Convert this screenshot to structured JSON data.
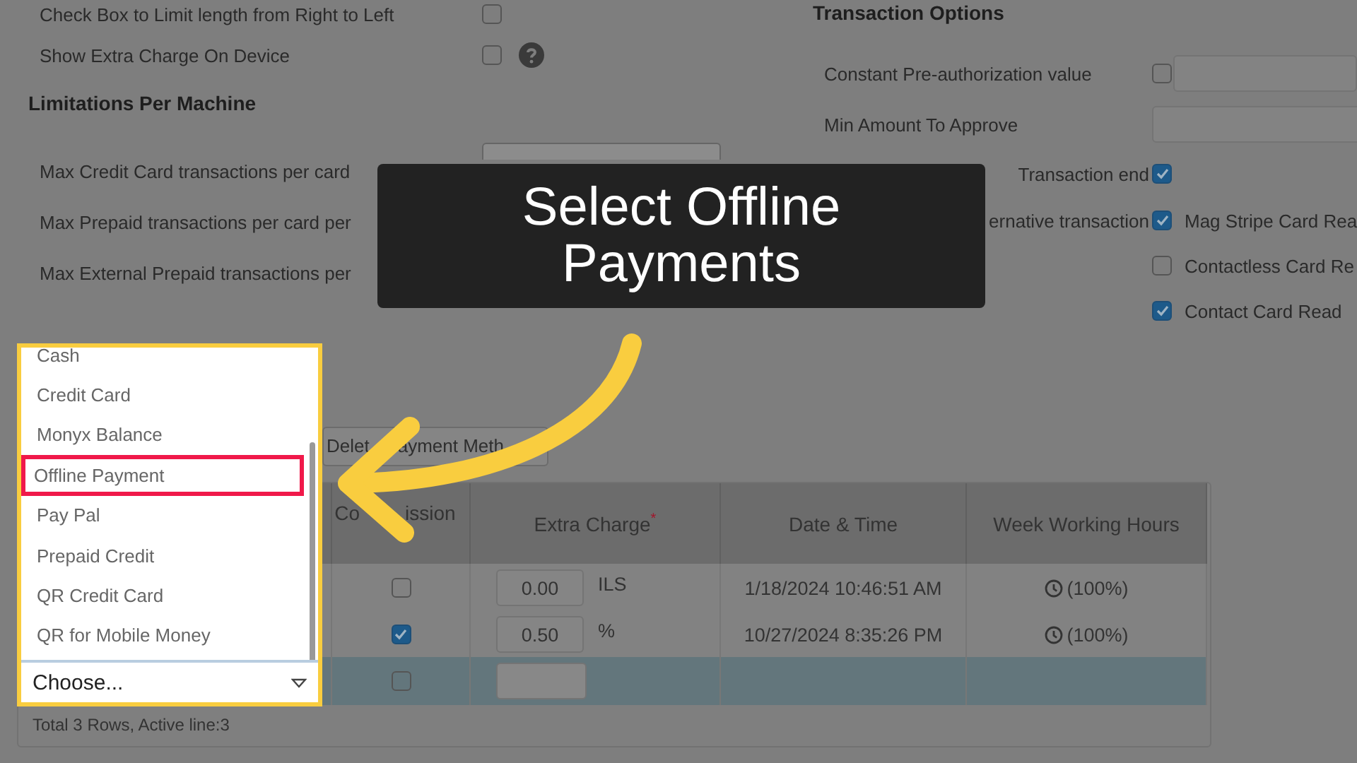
{
  "settings": {
    "rows": [
      {
        "label": "Check Box to Limit length from Right to Left",
        "checked": false
      },
      {
        "label": "Show Extra Charge On Device",
        "checked": false,
        "help": true
      }
    ]
  },
  "limitations": {
    "heading": "Limitations Per Machine",
    "rows": [
      {
        "label": "Max Credit Card transactions per card",
        "field": true
      },
      {
        "label": "Max Prepaid transactions per card per"
      },
      {
        "label": "Max External Prepaid transactions per"
      }
    ]
  },
  "transaction_options": {
    "heading": "Transaction Options",
    "rows": [
      {
        "kind": "checkbox_input",
        "label": "Constant Pre-authorization value",
        "checked": false
      },
      {
        "kind": "input",
        "label": "Min Amount To Approve"
      },
      {
        "kind": "checkbox",
        "label": "Transaction end",
        "checked": true
      },
      {
        "kind": "checkbox",
        "label": "ernative transaction",
        "checked": true,
        "option": "Mag Stripe Card Rea"
      },
      {
        "kind": "option",
        "option": "Contactless Card Re",
        "checked": false
      },
      {
        "kind": "option",
        "option": "Contact Card Read",
        "checked": true
      }
    ]
  },
  "toolbar": {
    "buttons": [
      {
        "parts": [
          "Delet",
          "ayment Meth"
        ]
      }
    ]
  },
  "table": {
    "columns": [
      {
        "parts": [
          "Co",
          "ission"
        ]
      },
      {
        "label": "Extra Charge",
        "required_mark": "*"
      },
      {
        "label": "Date & Time"
      },
      {
        "label": "Week Working Hours"
      }
    ],
    "rows": [
      {
        "selected": false,
        "commission": false,
        "extra_charge": "0.00",
        "unit": "ILS",
        "date_time": "1/18/2024 10:46:51 AM",
        "week_hours": "(100%)"
      },
      {
        "selected": false,
        "commission": true,
        "extra_charge": "0.50",
        "unit": "%",
        "date_time": "10/27/2024 8:35:26 PM",
        "week_hours": "(100%)"
      },
      {
        "selected": true,
        "commission": false
      }
    ],
    "footer": "Total 3 Rows, Active line:3"
  },
  "dropdown": {
    "options": [
      {
        "label": "Cash",
        "selected": false
      },
      {
        "label": "Credit Card",
        "selected": false
      },
      {
        "label": "Monyx Balance",
        "selected": false
      },
      {
        "label": "Offline Payment",
        "selected": true
      },
      {
        "label": "Pay Pal",
        "selected": false
      },
      {
        "label": "Prepaid Credit",
        "selected": false
      },
      {
        "label": "QR Credit Card",
        "selected": false
      },
      {
        "label": "QR for Mobile Money",
        "selected": false
      }
    ],
    "value": "Choose..."
  },
  "callout": {
    "text": "Select Offline Payments"
  }
}
